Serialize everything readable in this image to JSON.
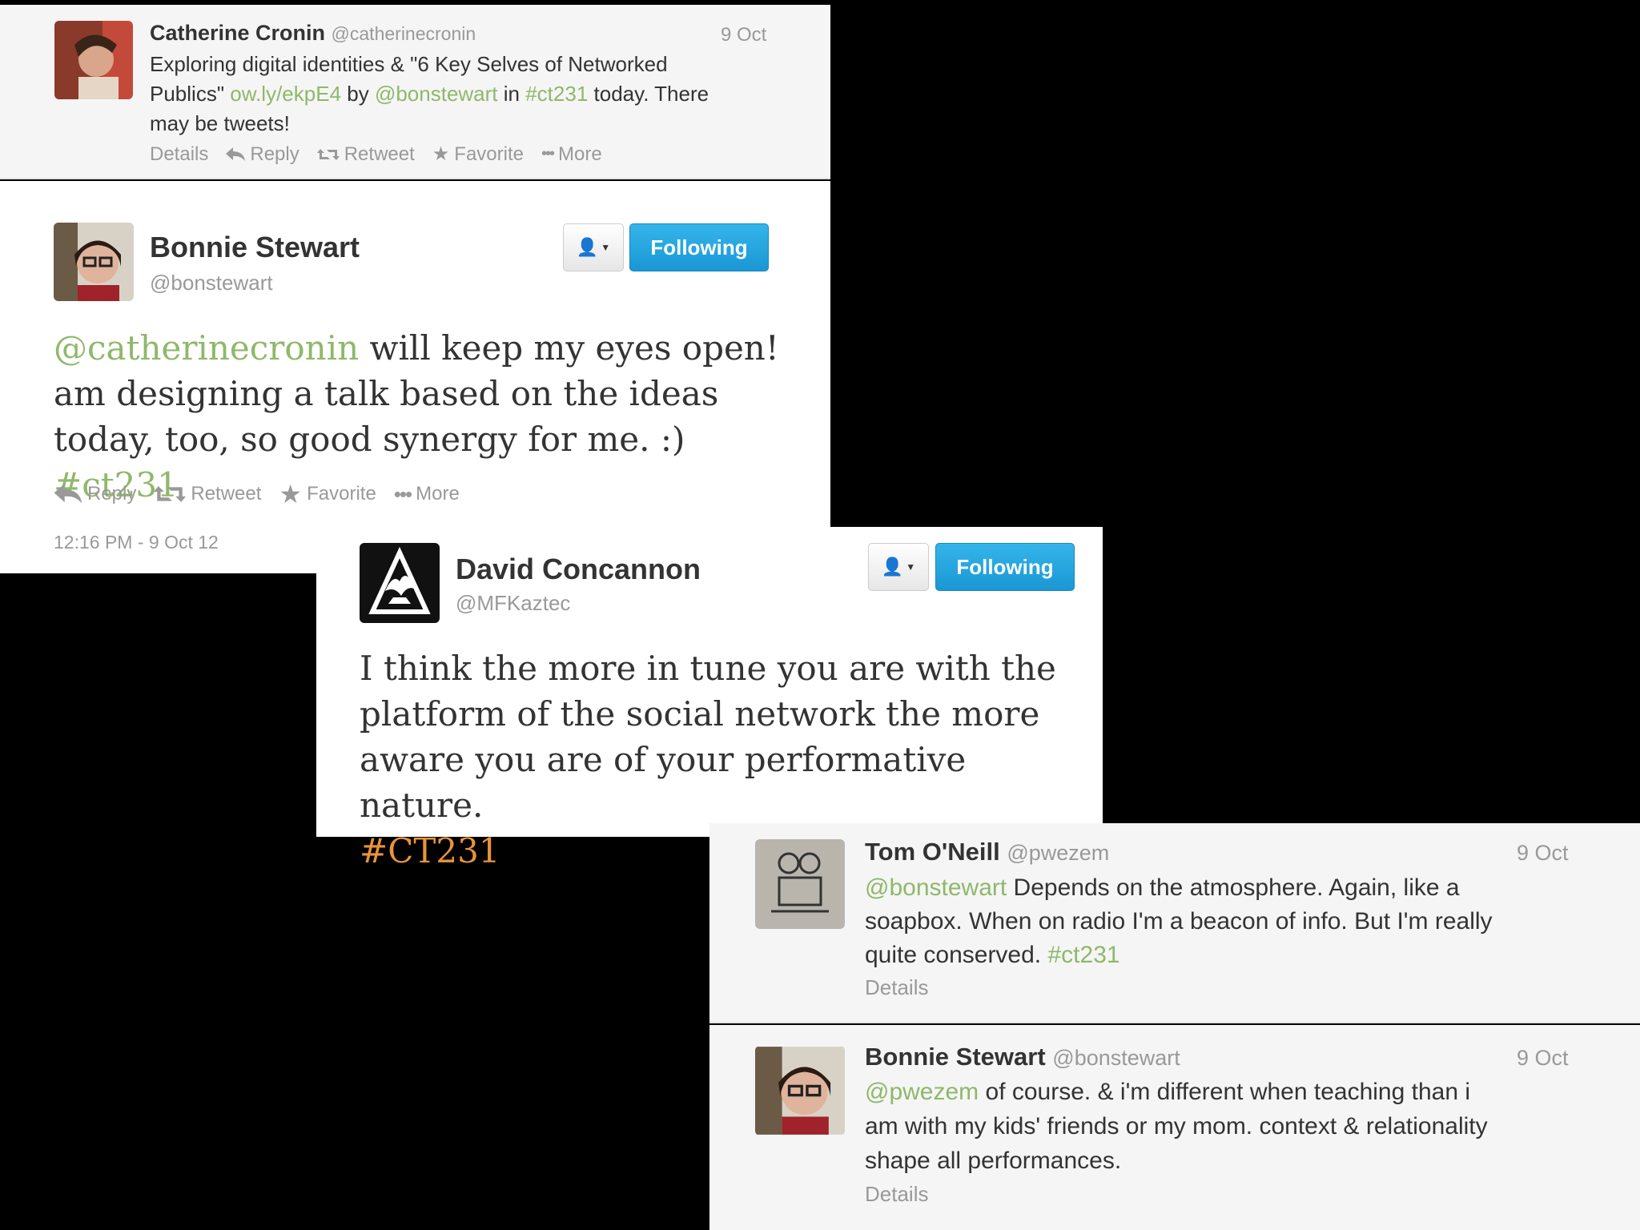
{
  "tweet1": {
    "name": "Catherine Cronin",
    "handle": "@catherinecronin",
    "date": "9 Oct",
    "text_line1": "Exploring digital identities & \"6 Key Selves of Networked",
    "text_line2_a": "Publics\" ",
    "link": "ow.ly/ekpE4",
    "text_line2_b": " by ",
    "mention": "@bonstewart",
    "text_line2_c": " in ",
    "hashtag": "#ct231",
    "text_line2_d": " today. There",
    "text_line3": "may be tweets!",
    "actions": {
      "details": "Details",
      "reply": "Reply",
      "retweet": "Retweet",
      "favorite": "Favorite",
      "more": "More"
    }
  },
  "tweet2": {
    "name": "Bonnie Stewart",
    "handle": "@bonstewart",
    "following_label": "Following",
    "mention": "@catherinecronin",
    "text_line1": " will keep my eyes open!",
    "text_line2": "am designing a talk based on the ideas",
    "text_line3": "today, too, so good synergy for me. :) ",
    "hashtag": "#ct231",
    "actions": {
      "reply": "Reply",
      "retweet": "Retweet",
      "favorite": "Favorite",
      "more": "More"
    },
    "timestamp": "12:16 PM - 9 Oct 12"
  },
  "tweet3": {
    "name": "David Concannon",
    "handle": "@MFKaztec",
    "following_label": "Following",
    "text_line1": "I think the more in tune you are with the",
    "text_line2": "platform of the social network the more",
    "text_line3": "aware you are of your performative nature.",
    "hashtag": "#CT231"
  },
  "tweet4": {
    "name": "Tom O'Neill",
    "handle": "@pwezem",
    "date": "9 Oct",
    "mention": "@bonstewart",
    "text_line1": " Depends on the atmosphere. Again, like a",
    "text_line2": "soapbox. When on radio I'm a beacon of info. But I'm really",
    "text_line3": "quite conserved. ",
    "hashtag": "#ct231",
    "details": "Details"
  },
  "tweet5": {
    "name": "Bonnie Stewart",
    "handle": "@bonstewart",
    "date": "9 Oct",
    "mention": "@pwezem",
    "text_line1": " of course. & i'm different when teaching than i",
    "text_line2": "am with my kids' friends or my mom. context & relationality",
    "text_line3": "shape all performances.",
    "details": "Details"
  },
  "colors": {
    "link_green": "#8fb86a",
    "hashtag_orange": "#e8943a",
    "follow_blue": "#2aa9e0"
  }
}
